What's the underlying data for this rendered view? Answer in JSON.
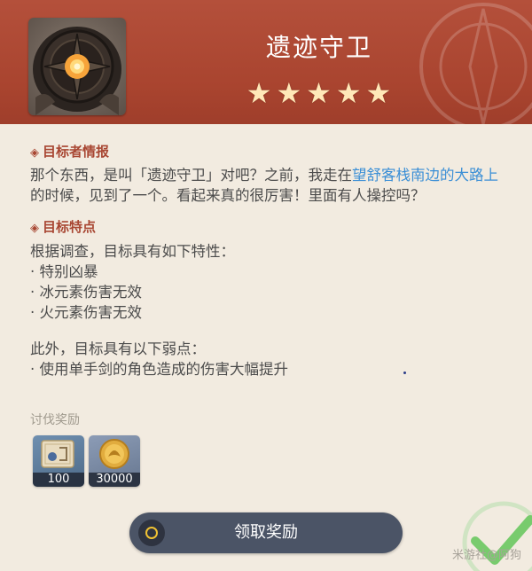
{
  "header": {
    "title": "遗迹守卫",
    "stars": [
      "★",
      "★",
      "★",
      "★",
      "★"
    ],
    "portrait_icon": "ruin-guard-core-icon"
  },
  "intel": {
    "heading": "目标者情报",
    "text_before": "那个东西，是叫「遗迹守卫」对吧？之前，我走在",
    "highlight": "望舒客栈南边的大路上",
    "text_after": "的时候，见到了一个。看起来真的很厉害！里面有人操控吗？"
  },
  "traits": {
    "heading": "目标特点",
    "intro": "根据调查，目标具有如下特性：",
    "items": [
      "· 特别凶暴",
      "· 冰元素伤害无效",
      "· 火元素伤害无效"
    ],
    "weak_intro": "此外，目标具有以下弱点：",
    "weak_items": [
      "· 使用单手剑的角色造成的伤害大幅提升"
    ]
  },
  "rewards": {
    "label": "讨伐奖励",
    "items": [
      {
        "name": "adventure-exp-icon",
        "qty": "100"
      },
      {
        "name": "mora-coin-icon",
        "qty": "30000"
      }
    ]
  },
  "claim_button": {
    "label": "领取奖励"
  },
  "watermark": "米游社@阿狗",
  "colors": {
    "header": "#a9442f",
    "accent": "#a84632",
    "highlight": "#3b8fd6",
    "button": "#4b5466",
    "check": "#63c65a"
  }
}
